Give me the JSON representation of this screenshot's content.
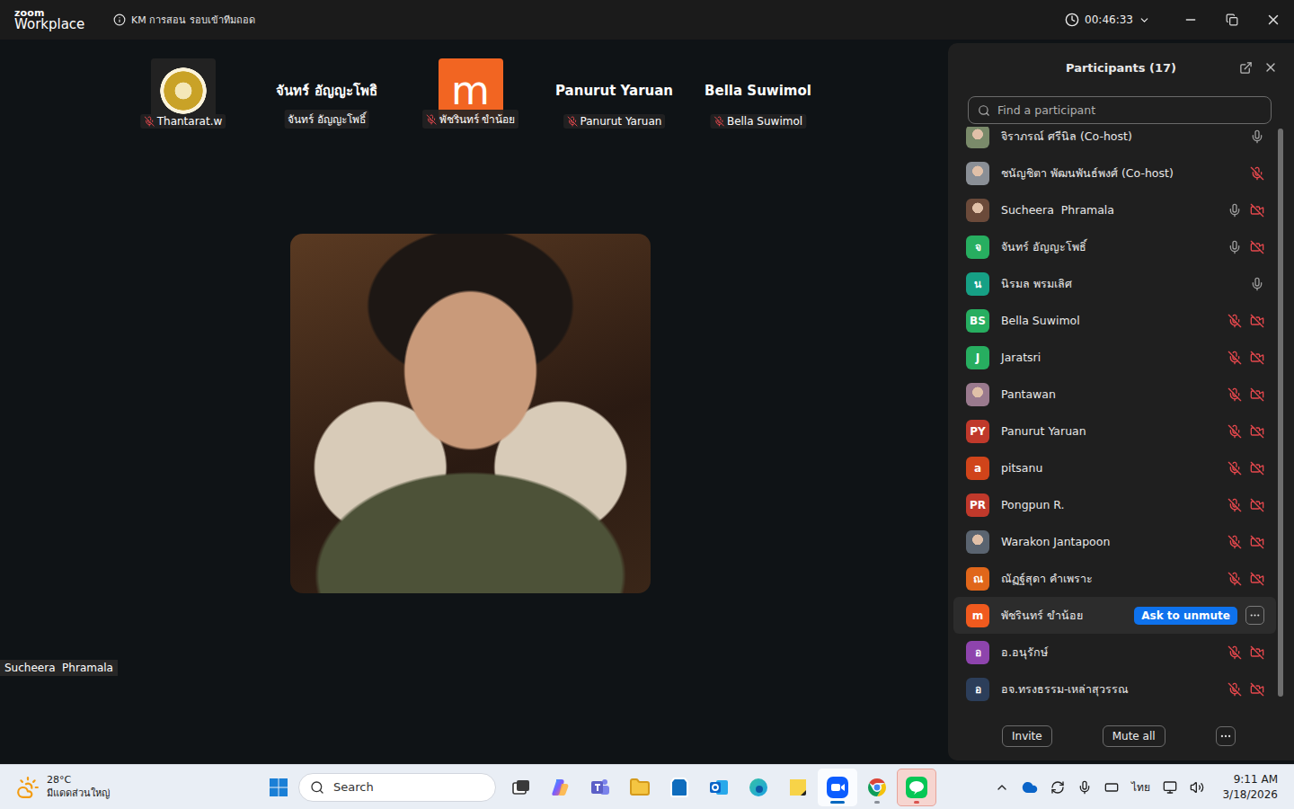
{
  "window": {
    "logo_top": "zoom",
    "logo_bottom": "Workplace",
    "title": "KM การสอน รอบเข้าทีมถอด",
    "timer": "00:46:33"
  },
  "gallery": [
    {
      "kind": "photo",
      "label": "Thantarat.w",
      "muted": true,
      "color": "#c9a227"
    },
    {
      "kind": "name",
      "name": "จันทร์ อัญญะโพธิ",
      "label": "จันทร์ อัญญะโพธิ์",
      "muted": false
    },
    {
      "kind": "letter",
      "letter": "m",
      "label": "พัชรินทร์ ขำน้อย",
      "muted": true,
      "color": "#f26522"
    },
    {
      "kind": "name",
      "name": "Panurut Yaruan",
      "label": "Panurut Yaruan",
      "muted": true
    },
    {
      "kind": "name",
      "name": "Bella Suwimol",
      "label": "Bella Suwimol",
      "muted": true
    }
  ],
  "speaker": {
    "label": "Sucheera  Phramala"
  },
  "participants_panel": {
    "title": "Participants (17)",
    "search_placeholder": "Find a participant",
    "rows": [
      {
        "name": "จิราภรณ์ ศรีนิล (Co-host)",
        "avatar": "photo",
        "letter": "",
        "color": "#7a8a6a",
        "mic": "on",
        "video": "none",
        "hovered": false
      },
      {
        "name": "ชนัญชิตา พัฒนพันธ์พงศ์ (Co-host)",
        "avatar": "photo",
        "letter": "",
        "color": "#8a8f96",
        "mic": "muted",
        "video": "none",
        "hovered": false
      },
      {
        "name": "Sucheera  Phramala",
        "avatar": "photo",
        "letter": "",
        "color": "#6b4a3a",
        "mic": "on",
        "video": "off",
        "hovered": false
      },
      {
        "name": "จันทร์ อัญญะโพธิ์",
        "avatar": "letter",
        "letter": "จ",
        "color": "#27ae60",
        "mic": "on",
        "video": "off",
        "hovered": false
      },
      {
        "name": "นิรมล พรมเลิศ",
        "avatar": "letter",
        "letter": "น",
        "color": "#16a085",
        "mic": "on",
        "video": "none",
        "hovered": false
      },
      {
        "name": "Bella Suwimol",
        "avatar": "letter",
        "letter": "BS",
        "color": "#27ae60",
        "mic": "muted",
        "video": "off",
        "hovered": false
      },
      {
        "name": "Jaratsri",
        "avatar": "letter",
        "letter": "J",
        "color": "#27ae60",
        "mic": "muted",
        "video": "off",
        "hovered": false
      },
      {
        "name": "Pantawan",
        "avatar": "photo",
        "letter": "",
        "color": "#9a7a8e",
        "mic": "muted",
        "video": "off",
        "hovered": false
      },
      {
        "name": "Panurut Yaruan",
        "avatar": "letter",
        "letter": "PY",
        "color": "#c0392b",
        "mic": "muted",
        "video": "off",
        "hovered": false
      },
      {
        "name": "pitsanu",
        "avatar": "letter",
        "letter": "a",
        "color": "#d0441a",
        "mic": "muted",
        "video": "off",
        "hovered": false
      },
      {
        "name": "Pongpun R.",
        "avatar": "letter",
        "letter": "PR",
        "color": "#c0392b",
        "mic": "muted",
        "video": "off",
        "hovered": false
      },
      {
        "name": "Warakon Jantapoon",
        "avatar": "photo",
        "letter": "",
        "color": "#5a6470",
        "mic": "muted",
        "video": "off",
        "hovered": false
      },
      {
        "name": "ณัฏฐ์สุดา คำเพราะ",
        "avatar": "letter",
        "letter": "ณ",
        "color": "#e0661a",
        "mic": "muted",
        "video": "off",
        "hovered": false
      },
      {
        "name": "พัชรินทร์ ขำน้อย",
        "avatar": "letter",
        "letter": "m",
        "color": "#f05a1e",
        "mic": "muted",
        "video": "off",
        "hovered": true,
        "action": "Ask to unmute"
      },
      {
        "name": "อ.อนุรักษ์",
        "avatar": "letter",
        "letter": "อ",
        "color": "#8e44ad",
        "mic": "muted",
        "video": "off",
        "hovered": false
      },
      {
        "name": "อจ.ทรงธรรม-เหล่าสุวรรณ",
        "avatar": "letter",
        "letter": "อ",
        "color": "#2c3e5a",
        "mic": "muted",
        "video": "off",
        "hovered": false
      }
    ],
    "buttons": [
      "Invite",
      "Mute all"
    ]
  },
  "taskbar": {
    "weather": {
      "temp": "28°C",
      "text": "มีแดดส่วนใหญ่"
    },
    "search": "Search",
    "apps": [
      {
        "state": "normal",
        "color": "#3a3a3a"
      },
      {
        "state": "normal",
        "color": "#7b5cff"
      },
      {
        "state": "normal",
        "color": "#5b5fc7"
      },
      {
        "state": "normal",
        "color": "#f4c542"
      },
      {
        "state": "normal",
        "color": "#0f6cbd"
      },
      {
        "state": "normal",
        "color": "#0a64c8"
      },
      {
        "state": "normal",
        "color": "#1ba1e2"
      },
      {
        "state": "normal",
        "color": "#f7d348"
      },
      {
        "state": "active",
        "color": "#0b5cff"
      },
      {
        "state": "running",
        "color": "#db4437"
      },
      {
        "state": "flashing",
        "color": "#06c755"
      }
    ],
    "language": "ไทย",
    "time": "9:11 AM",
    "date": "3/18/2026"
  }
}
